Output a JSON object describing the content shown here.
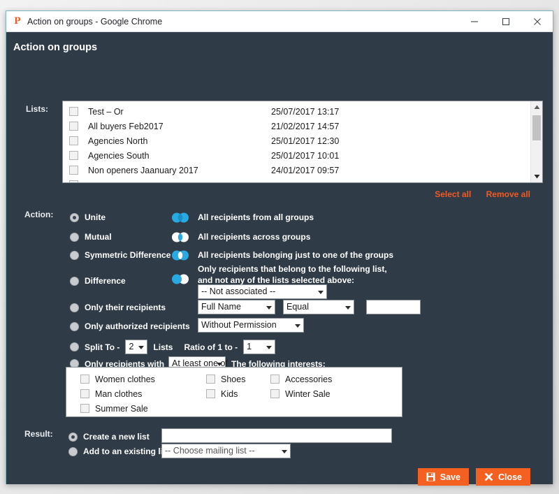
{
  "window": {
    "favicon_letter": "P",
    "title": "Action on groups - Google Chrome",
    "minimize_label": "Minimize",
    "maximize_label": "Maximize",
    "close_label": "Close"
  },
  "page": {
    "heading": "Action on groups",
    "labels": {
      "lists": "Lists:",
      "action": "Action:",
      "result": "Result:"
    }
  },
  "lists": {
    "items": [
      {
        "name": "Test – Or",
        "date": "25/07/2017 13:17",
        "checked": false
      },
      {
        "name": "All buyers Feb2017",
        "date": "21/02/2017 14:57",
        "checked": false
      },
      {
        "name": "Agencies North",
        "date": "25/01/2017 12:30",
        "checked": false
      },
      {
        "name": "Agencies South",
        "date": "25/01/2017 10:01",
        "checked": false
      },
      {
        "name": "Non openers Jaanuary 2017",
        "date": "24/01/2017 09:57",
        "checked": false
      }
    ],
    "select_all": "Select all",
    "remove_all": "Remove all"
  },
  "action": {
    "options": [
      {
        "label": "Unite",
        "selected": true,
        "icon": "venn-union-icon",
        "description": "All recipients from all groups"
      },
      {
        "label": "Mutual",
        "selected": false,
        "icon": "venn-intersection-icon",
        "description": "All recipients across groups"
      },
      {
        "label": "Symmetric Difference",
        "selected": false,
        "icon": "venn-symmetric-difference-icon",
        "description": "All recipients belonging just to one of the groups"
      },
      {
        "label": "Difference",
        "selected": false,
        "icon": "venn-difference-icon",
        "description_line1": "Only recipients that belong to the following list,",
        "description_line2": "and not any of the lists selected above:"
      }
    ],
    "difference_select": {
      "value": "-- Not associated --"
    },
    "only_their_recipients": {
      "label": "Only their recipients",
      "selected": false,
      "field_select": "Full Name",
      "operator_select": "Equal",
      "value_input": "",
      "value_placeholder": ""
    },
    "only_authorized_recipients": {
      "label": "Only authorized recipients",
      "selected": false,
      "permission_select": "Without Permission"
    },
    "split_to": {
      "label_before": "Split To -",
      "selected": false,
      "lists_count": "2",
      "label_middle": "Lists",
      "label_ratio": "Ratio of 1 to -",
      "ratio": "1"
    },
    "only_recipients_with": {
      "label_before": "Only recipients with",
      "selected": false,
      "match_select": "At least one of",
      "label_after": "The following interests:"
    },
    "interests": [
      {
        "label": "Women clothes",
        "checked": false
      },
      {
        "label": "Shoes",
        "checked": false
      },
      {
        "label": "Accessories",
        "checked": false
      },
      {
        "label": "Man clothes",
        "checked": false
      },
      {
        "label": "Kids",
        "checked": false
      },
      {
        "label": "Winter Sale",
        "checked": false
      },
      {
        "label": "Summer Sale",
        "checked": false
      }
    ]
  },
  "result": {
    "create_new": {
      "label": "Create a new list",
      "selected": true,
      "input_value": "",
      "input_placeholder": ""
    },
    "add_existing": {
      "label": "Add to an existing list",
      "selected": false,
      "select_value": "-- Choose mailing list --"
    }
  },
  "footer": {
    "save_label": "Save",
    "close_label": "Close"
  },
  "colors": {
    "background": "#2f3b47",
    "accent_orange": "#f4601f",
    "link_orange": "#f15a22",
    "venn_blue": "#29a9e1",
    "window_border": "#7fb6bd"
  }
}
